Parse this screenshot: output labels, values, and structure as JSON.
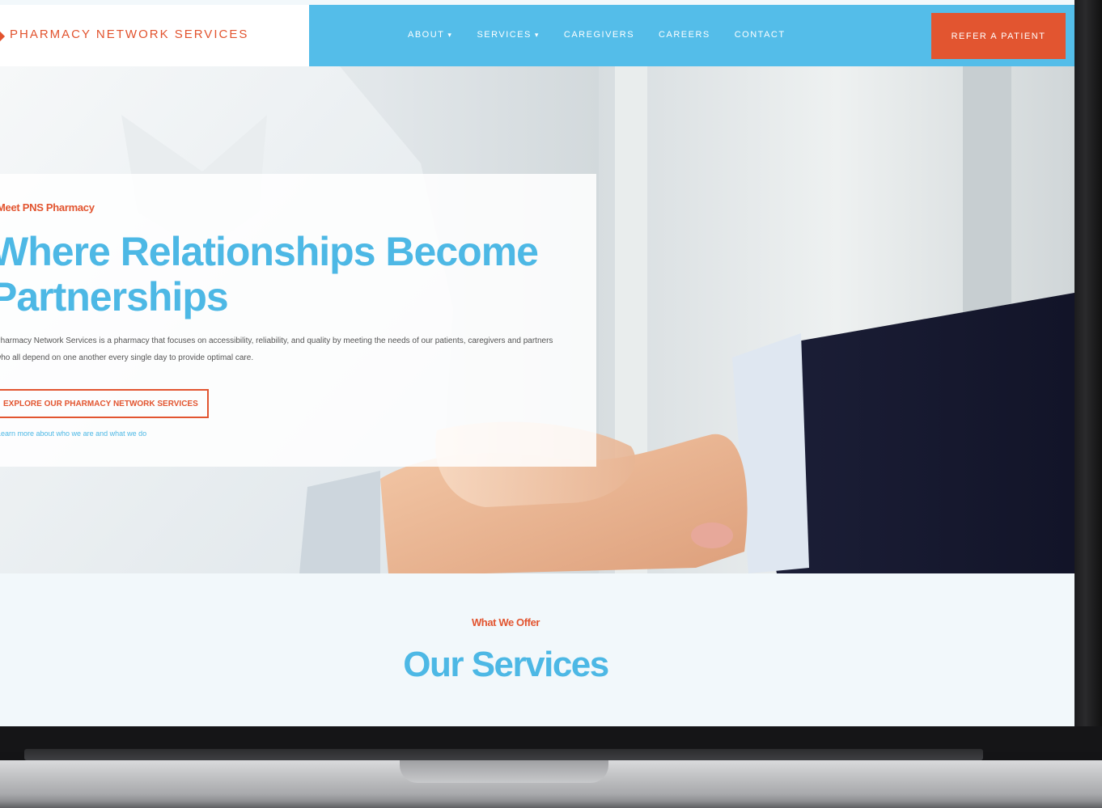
{
  "header": {
    "logo_text": "PHARMACY NETWORK SERVICES",
    "nav": [
      {
        "label": "ABOUT",
        "caret": "▾"
      },
      {
        "label": "SERVICES",
        "caret": "▾"
      },
      {
        "label": "CAREGIVERS",
        "caret": ""
      },
      {
        "label": "CAREERS",
        "caret": ""
      },
      {
        "label": "CONTACT",
        "caret": ""
      }
    ],
    "cta_label": "REFER A PATIENT"
  },
  "hero": {
    "eyebrow": "Meet PNS Pharmacy",
    "title": "Where Relationships Become Partnerships",
    "body": "Pharmacy Network Services is a pharmacy that focuses on accessibility, reliability, and quality by meeting the needs of our patients, caregivers and partners who all depend on one another every single day to provide optimal care.",
    "button_label": "EXPLORE OUR PHARMACY NETWORK SERVICES",
    "link_text": "Learn more about who we are and what we do"
  },
  "services": {
    "eyebrow": "What We Offer",
    "title": "Our Services"
  },
  "colors": {
    "brand_blue": "#54bde9",
    "accent_orange": "#e25530",
    "title_blue": "#4db8e5"
  }
}
